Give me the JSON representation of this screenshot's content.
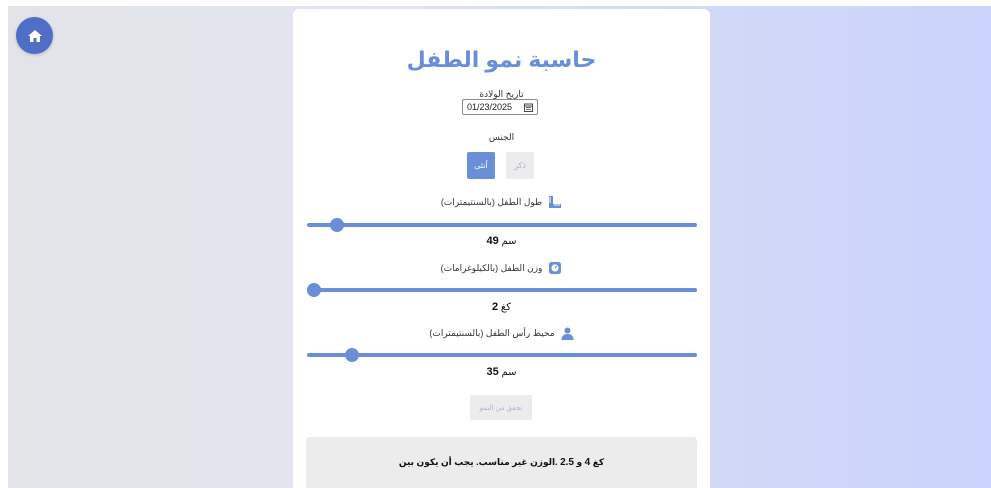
{
  "colors": {
    "accent": "#6a8ed8",
    "home_button": "#4f6fc7",
    "disabled_button": "#ececec",
    "disabled_text": "#a9b4d6"
  },
  "nav": {
    "home_icon": "home-icon"
  },
  "app": {
    "title": "حاسبة نمو الطفل"
  },
  "birth_date": {
    "label": "تاريخ الولادة",
    "value": "01/23/2025",
    "icon": "calendar-icon"
  },
  "gender": {
    "label": "الجنس",
    "options": [
      {
        "label": "أنثى",
        "selected": true
      },
      {
        "label": "ذكر",
        "selected": false
      }
    ]
  },
  "length": {
    "label": "طول الطفل (بالسنتيمترات)",
    "icon": "ruler-icon",
    "value": "49",
    "unit": "سم",
    "level": 0.06
  },
  "weight": {
    "label": "وزن الطفل (بالكيلوغرامات)",
    "icon": "scale-icon",
    "value": "2",
    "unit": "كغ",
    "level": 0.0
  },
  "head": {
    "label": "محيط رأس الطفل (بالسنتيمترات)",
    "icon": "user-icon",
    "value": "35",
    "unit": "سم",
    "level": 0.1
  },
  "check_button": {
    "label": "تحقق من النمو"
  },
  "result": {
    "prefix": ".الوزن غير مناسب. يجب أن يكون بين",
    "min": "2.5",
    "connector": "و",
    "max": "4",
    "unit": "كغ"
  }
}
